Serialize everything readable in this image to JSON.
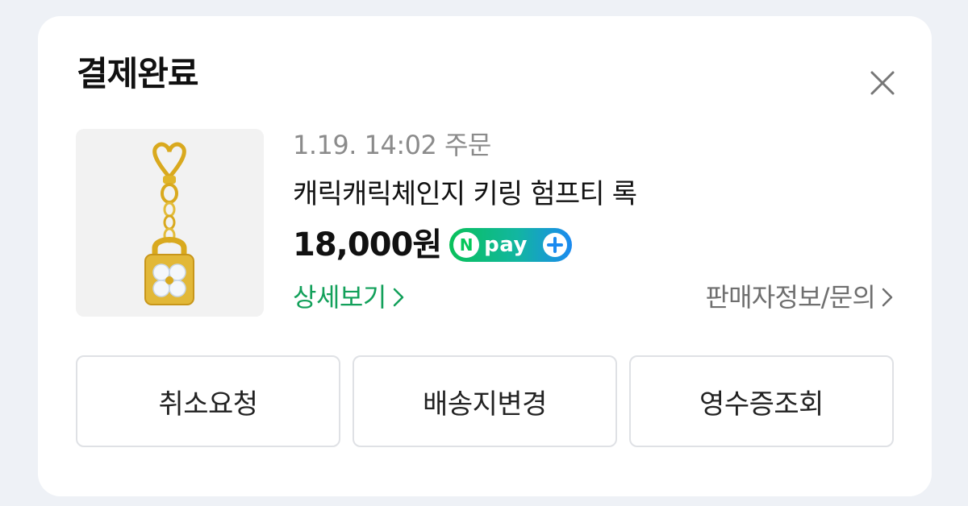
{
  "dialog": {
    "title": "결제완료",
    "close_icon": "close-icon"
  },
  "order": {
    "date": "1.19. 14:02 주문",
    "product_name": "캐릭캐릭체인지 키링 험프티 록",
    "price": "18,000원",
    "product_image_icon": "keyring-lock-image"
  },
  "badge": {
    "n_letter": "N",
    "pay_text": "pay",
    "colors": {
      "start": "#09c15a",
      "end": "#1b8af0"
    }
  },
  "links": {
    "detail": "상세보기",
    "seller": "판매자정보/문의"
  },
  "actions": [
    {
      "label": "취소요청"
    },
    {
      "label": "배송지변경"
    },
    {
      "label": "영수증조회"
    }
  ],
  "colors": {
    "accent_green": "#12a05a",
    "background": "#eef1f6",
    "card": "#ffffff"
  }
}
